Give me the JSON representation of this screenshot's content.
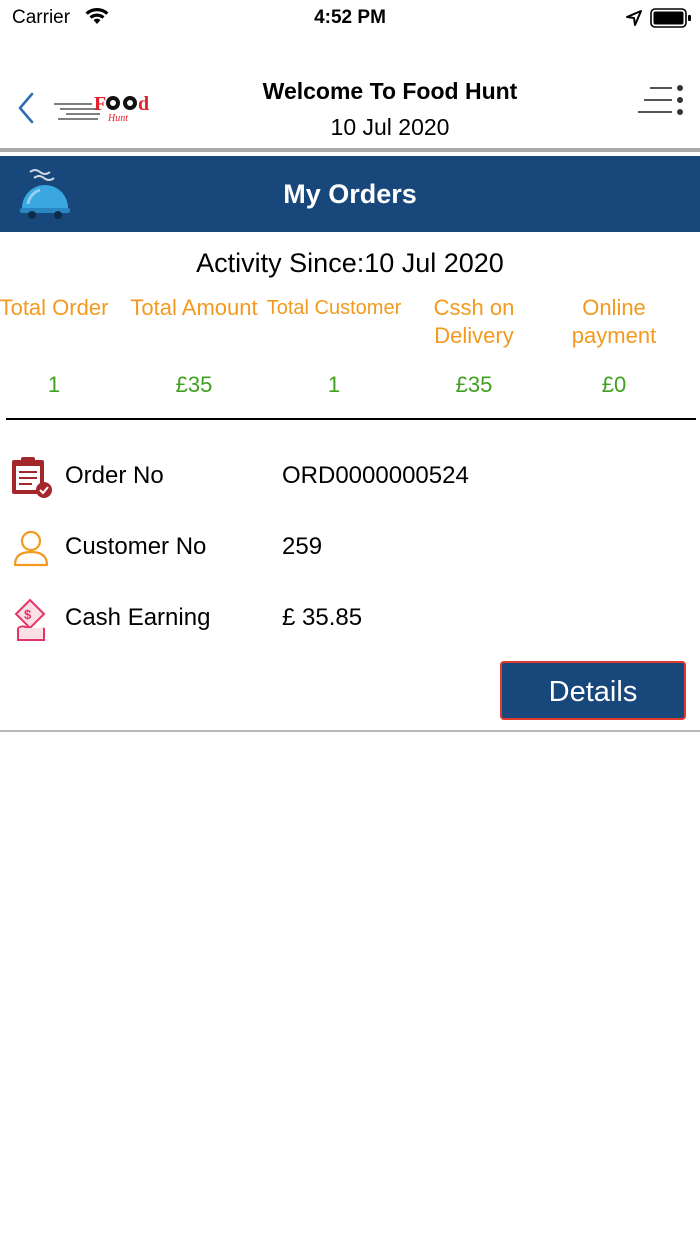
{
  "status_bar": {
    "carrier": "Carrier",
    "time": "4:52 PM",
    "icons": [
      "wifi-icon",
      "location-arrow-icon",
      "battery-icon"
    ]
  },
  "header": {
    "title": "Welcome To Food Hunt",
    "date": "10 Jul 2020",
    "logo": {
      "word": "Food",
      "tagline": "Hunt"
    },
    "icons": [
      "back-chevron-icon",
      "menu-icon"
    ]
  },
  "banner": {
    "title": "My Orders",
    "icon": "delivery-cloche-icon",
    "color": "#17477b"
  },
  "activity": {
    "since": "Activity Since:10 Jul 2020",
    "stats": [
      {
        "label": "Total Order",
        "value": "1"
      },
      {
        "label": "Total Amount",
        "value": "£35"
      },
      {
        "label": "Total Customer",
        "value": "1"
      },
      {
        "label": "Cssh on Delivery",
        "value": "£35"
      },
      {
        "label": "Online payment",
        "value": "£0"
      }
    ],
    "label_color": "#f29a1f",
    "value_color": "#3fa11e"
  },
  "order": {
    "rows": [
      {
        "label": "Order No",
        "value": "ORD0000000524",
        "icon": "order-clipboard-icon"
      },
      {
        "label": "Customer No",
        "value": "259",
        "icon": "customer-person-icon"
      },
      {
        "label": "Cash Earning",
        "value": "£ 35.85",
        "icon": "cash-earning-icon"
      }
    ],
    "details_button": "Details",
    "button_border_color": "#e23a2e"
  }
}
